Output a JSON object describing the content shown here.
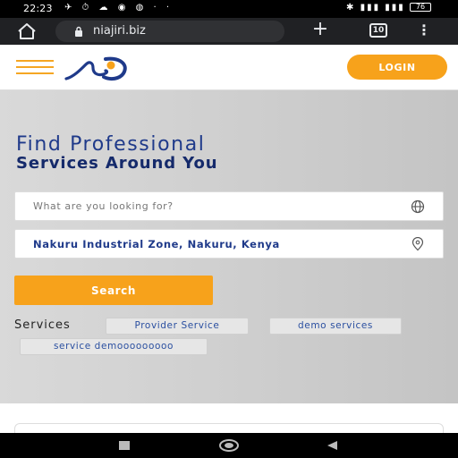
{
  "status_bar": {
    "time": "22:23",
    "left_icons": "✈ ⏱ ☁ ◉ ◍ · ·",
    "right_icons": "✱ ▮▮▮ ▮▮▮",
    "battery": "76"
  },
  "browser": {
    "url": "niajiri.biz",
    "tab_count": "10",
    "plus": "+",
    "menu": "⋮"
  },
  "header": {
    "login_label": "LOGIN"
  },
  "hero": {
    "title_line1": "Find Professional",
    "title_line2": "Services Around You",
    "search_placeholder": "What are you looking for?",
    "location_value": "Nakuru Industrial Zone, Nakuru, Kenya",
    "search_button": "Search",
    "services_label": "Services",
    "services": [
      "Provider Service",
      "demo services",
      "service demooooooooo"
    ]
  },
  "colors": {
    "accent": "#f7a21b",
    "brand_navy": "#1f3a8a"
  }
}
